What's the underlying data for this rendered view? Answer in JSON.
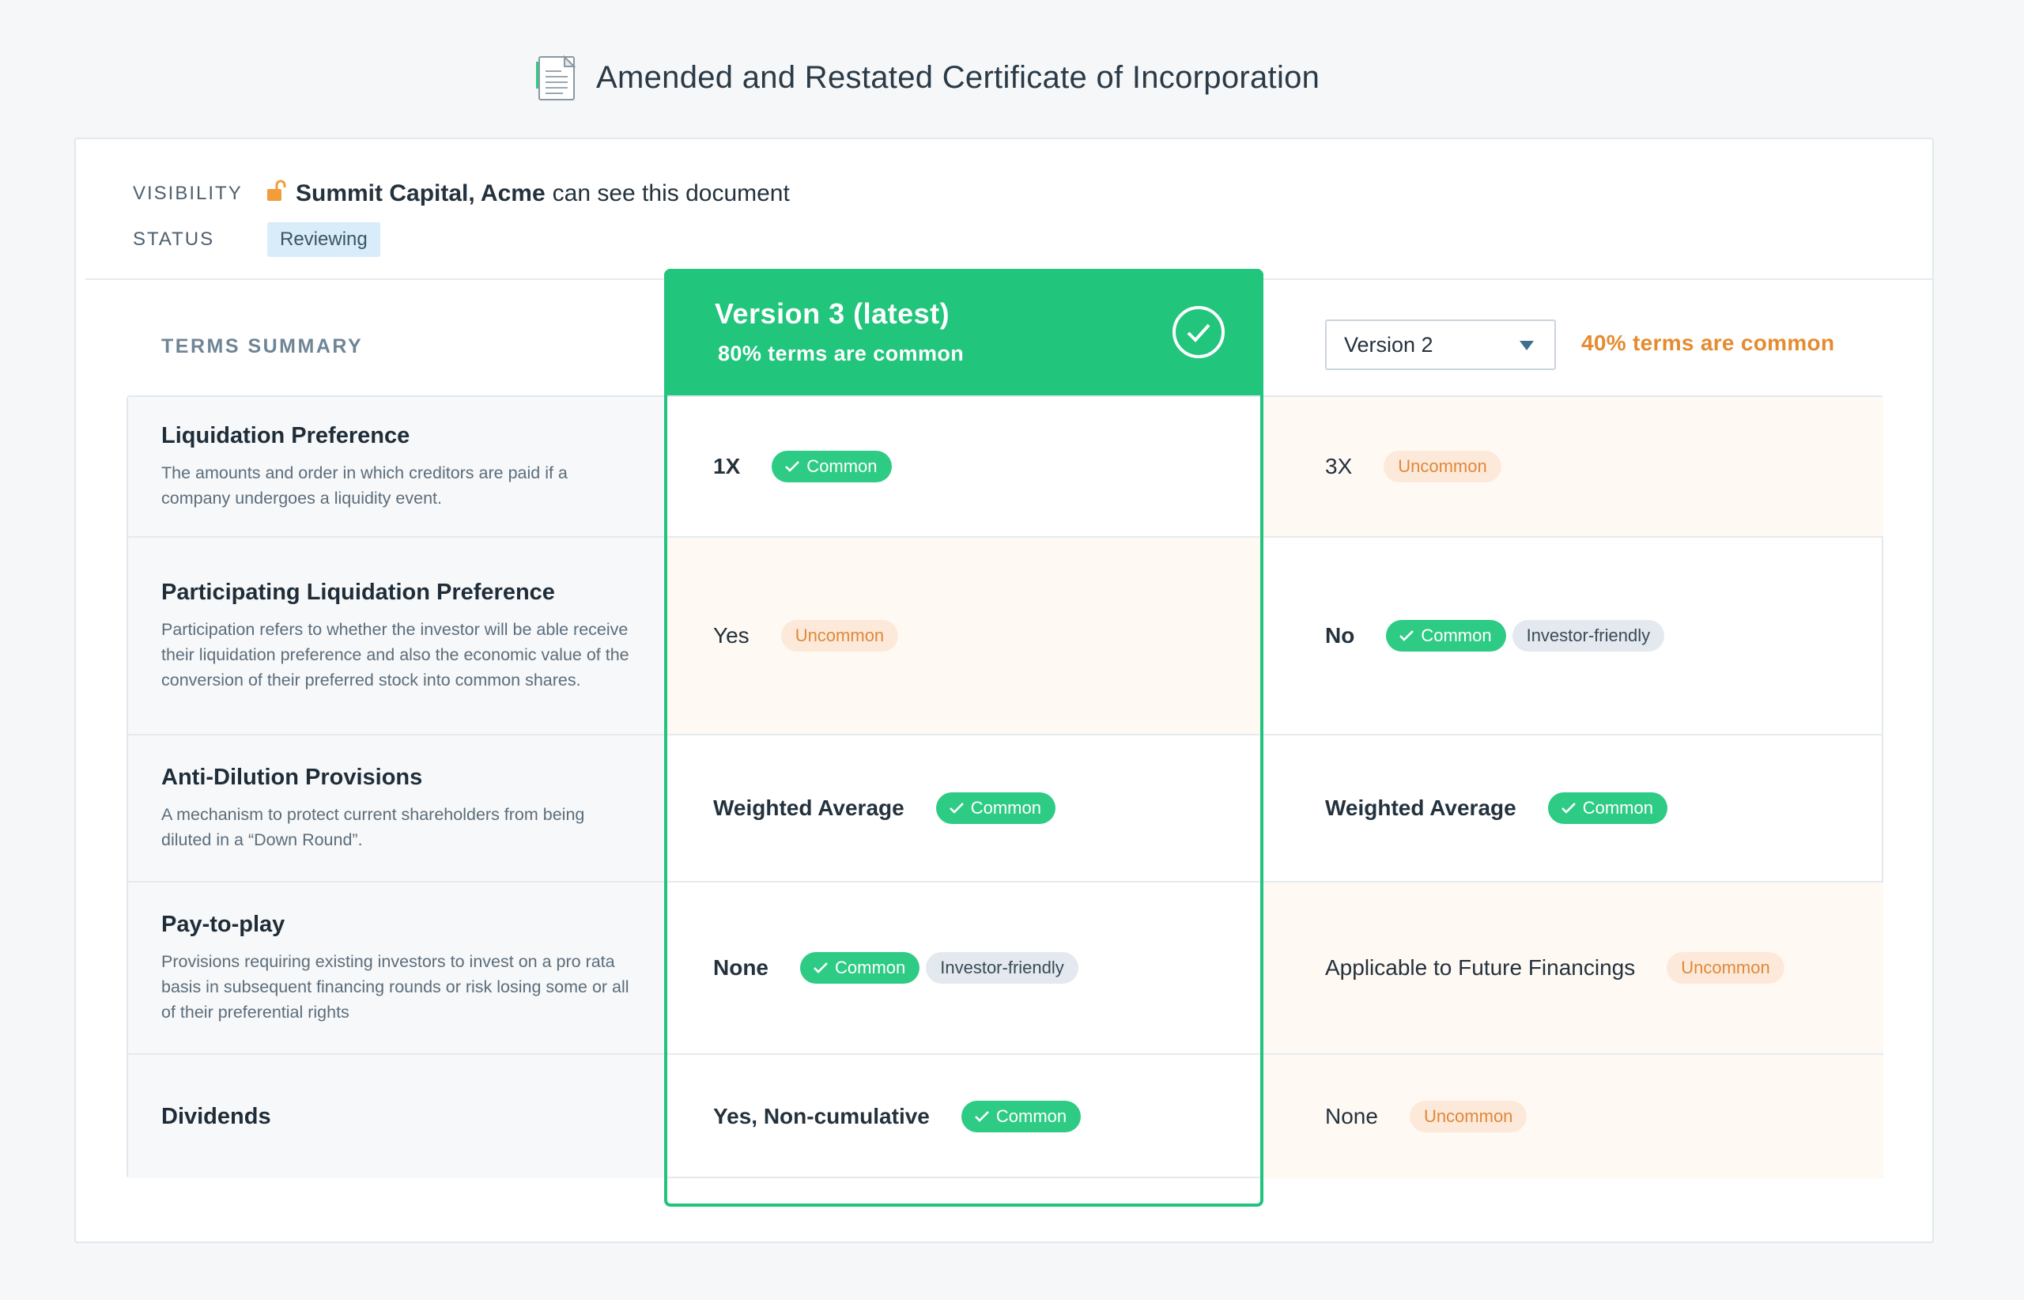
{
  "header": {
    "title": "Amended and Restated Certificate of Incorporation",
    "icon": "document-icon"
  },
  "meta": {
    "visibility_label": "VISIBILITY",
    "visibility_names": "Summit Capital, Acme",
    "visibility_suffix": "can see this document",
    "status_label": "STATUS",
    "status_value": "Reviewing"
  },
  "terms_summary_label": "TERMS SUMMARY",
  "version_current": {
    "title": "Version 3 (latest)",
    "subtitle": "80% terms are common"
  },
  "version_compare": {
    "selected": "Version 2",
    "summary": "40% terms are common"
  },
  "badges": {
    "common": "Common",
    "uncommon": "Uncommon",
    "investor": "Investor-friendly"
  },
  "terms": [
    {
      "title": "Liquidation Preference",
      "description": "The amounts and order in which creditors are paid if a company undergoes a liquidity event.",
      "v3_value": "1X",
      "v2_value": "3X"
    },
    {
      "title": "Participating Liquidation Preference",
      "description": "Participation refers to whether the investor will be able receive their liquidation preference and also the economic value of the conversion of their preferred stock into common shares.",
      "v3_value": "Yes",
      "v2_value": "No"
    },
    {
      "title": "Anti-Dilution Provisions",
      "description": "A mechanism to protect current shareholders from being diluted in a “Down Round”.",
      "v3_value": "Weighted Average",
      "v2_value": "Weighted Average"
    },
    {
      "title": "Pay-to-play",
      "description": "Provisions requiring existing investors to invest on a pro rata basis in subsequent financing rounds or risk losing some or all of their preferential rights",
      "v3_value": "None",
      "v2_value": "Applicable to Future Financings"
    },
    {
      "title": "Dividends",
      "description": "",
      "v3_value": "Yes, Non-cumulative",
      "v2_value": "None"
    }
  ],
  "colors": {
    "accent_green": "#21c57c",
    "uncommon_orange": "#e58b2f",
    "status_blue": "#d8ecf9"
  }
}
